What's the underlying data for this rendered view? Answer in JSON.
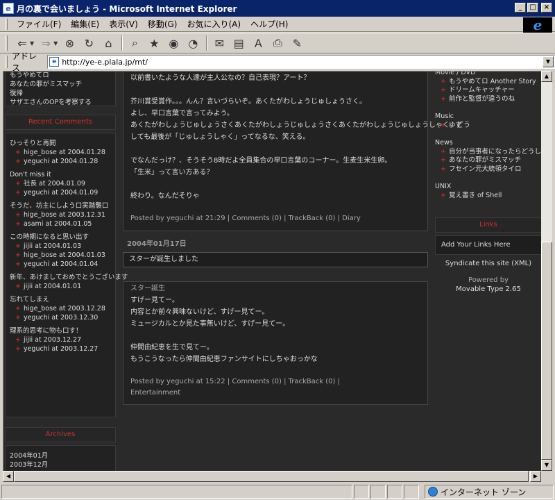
{
  "window": {
    "title": "月の裏で会いましょう - Microsoft Internet Explorer",
    "minimize": "_",
    "maximize": "□",
    "close": "×"
  },
  "menu": [
    "ファイル(F)",
    "編集(E)",
    "表示(V)",
    "移動(G)",
    "お気に入り(A)",
    "ヘルプ(H)"
  ],
  "address": {
    "label": "アドレス",
    "url": "http://ye-e.plala.jp/mt/"
  },
  "status": {
    "zone": "インターネット ゾーン"
  },
  "left": {
    "top_items": [
      "もうやめてロ",
      "あなたの罪がミスマッチ",
      "復帰",
      "サザエさんのOPを考察する"
    ],
    "recent_comments_heading": "Recent Comments",
    "recent_comments": [
      {
        "title": "ひっそりと再開",
        "entries": [
          "hige_bose  at 2004.01.28",
          "yeguchi  at 2004.01.28"
        ]
      },
      {
        "title": "Don't miss it",
        "entries": [
          "社長  at 2004.01.09",
          "yeguchi  at 2004.01.09"
        ]
      },
      {
        "title": "そうだ、坊主にしよう口実踏襲口",
        "entries": [
          "hige_bose  at 2003.12.31",
          "asami  at 2004.01.05"
        ]
      },
      {
        "title": "この時期になると思い出す",
        "entries": [
          "jijii  at 2004.01.03",
          "hige_bose  at 2004.01.03",
          "yeguchi  at 2004.01.04"
        ]
      },
      {
        "title": "新年、あけましておめでとうございます",
        "entries": [
          "jijii  at 2004.01.01"
        ]
      },
      {
        "title": "忘れてしまえ",
        "entries": [
          "hige_bose  at 2003.12.28",
          "yeguchi  at 2003.12.30"
        ]
      },
      {
        "title": "理系的思考に物も口す！",
        "entries": [
          "jijii  at 2003.12.27",
          "yeguchi  at 2003.12.27"
        ]
      }
    ],
    "archives_heading": "Archives",
    "archives": [
      "2004年01月",
      "2003年12月"
    ]
  },
  "post1": {
    "lines": [
      "以前書いたような人達が主人公なの？自己表現？アート？",
      "",
      "芥川賞受賞作。。。んん？言いづらいぞ。あくたがわしょうじゅしょうさく。",
      "よし、早口言葉で言ってみよう。",
      "あくたがわしょうじゅしょうさくあくたがわしょうじゅしょうさくあくたがわしょうじゅしょうしゃく。どう",
      "しても最後が「じゅしょうしゃく」ってなるな、笑える。",
      "",
      "でなんだっけ？、そうそう8時だよ全員集合の早口言葉のコーナー。生麦生米生卵。",
      "「生米」って言い方ある？",
      "",
      "終わり。なんだそりゃ"
    ],
    "meta": "Posted by yeguchi at 21:29 | Comments (0) | TrackBack (0) | Diary"
  },
  "date_heading": "2004年01月17日",
  "post2": {
    "title": "スターが誕生しました",
    "subtitle": "スター誕生",
    "lines": [
      "すげー見てー。",
      "内容とか前々興味ないけど、すげー見てー。",
      "ミュージカルとか見た事無いけど、すげー見てー。",
      "",
      "仲間由紀恵を生で見てー。",
      "もうこうなったら仲間由紀恵ファンサイトにしちゃおっかな"
    ],
    "meta1": "Posted by yeguchi at 15:22 | Comments (0) | TrackBack (0) |",
    "meta2": "Entertainment"
  },
  "right": {
    "sections": [
      {
        "heading": "Movie / DVD",
        "items": [
          "もうやめてロ Another Story",
          "ドリームキャッチャー",
          "前作と監督が違うのね"
        ]
      },
      {
        "heading": "Music",
        "items": [
          "ゆず"
        ]
      },
      {
        "heading": "News",
        "items": [
          "自分が当事者になったらどうしよう",
          "あなたの罪がミスマッチ",
          "フセイン元大統領タイロ"
        ]
      },
      {
        "heading": "UNIX",
        "items": [
          "覚え書き of Shell"
        ]
      }
    ],
    "links_heading": "Links",
    "add_links": "Add Your Links Here",
    "syndicate": "Syndicate this site (XML)",
    "powered_by": "Powered by",
    "powered_name": "Movable Type 2.65"
  }
}
